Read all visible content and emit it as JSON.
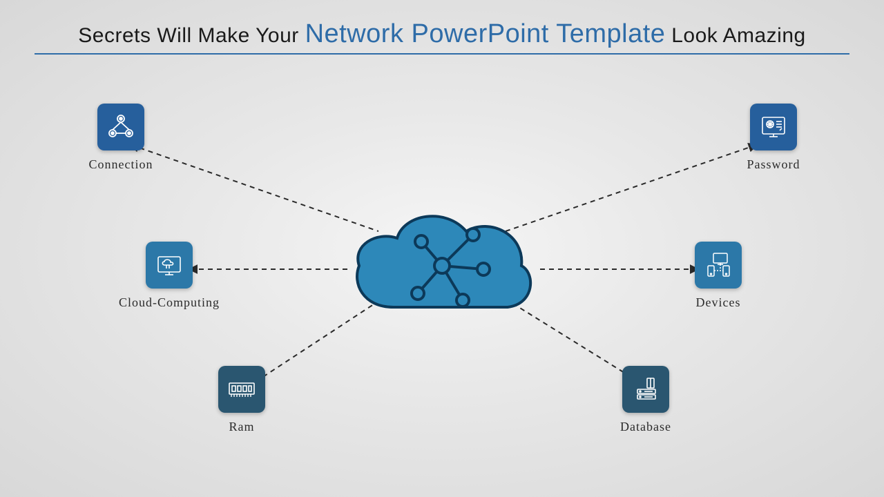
{
  "title": {
    "prefix": "Secrets Will Make Your ",
    "em": "Network PowerPoint Template",
    "suffix": " Look Amazing"
  },
  "nodes": {
    "connection": {
      "label": "Connection",
      "icon": "connection-icon"
    },
    "cloud_computing": {
      "label": "Cloud-Computing",
      "icon": "cloud-computing-icon"
    },
    "ram": {
      "label": "Ram",
      "icon": "ram-icon"
    },
    "password": {
      "label": "Password",
      "icon": "password-icon"
    },
    "devices": {
      "label": "Devices",
      "icon": "devices-icon"
    },
    "database": {
      "label": "Database",
      "icon": "database-icon"
    }
  },
  "center": {
    "icon": "cloud-network-icon"
  }
}
